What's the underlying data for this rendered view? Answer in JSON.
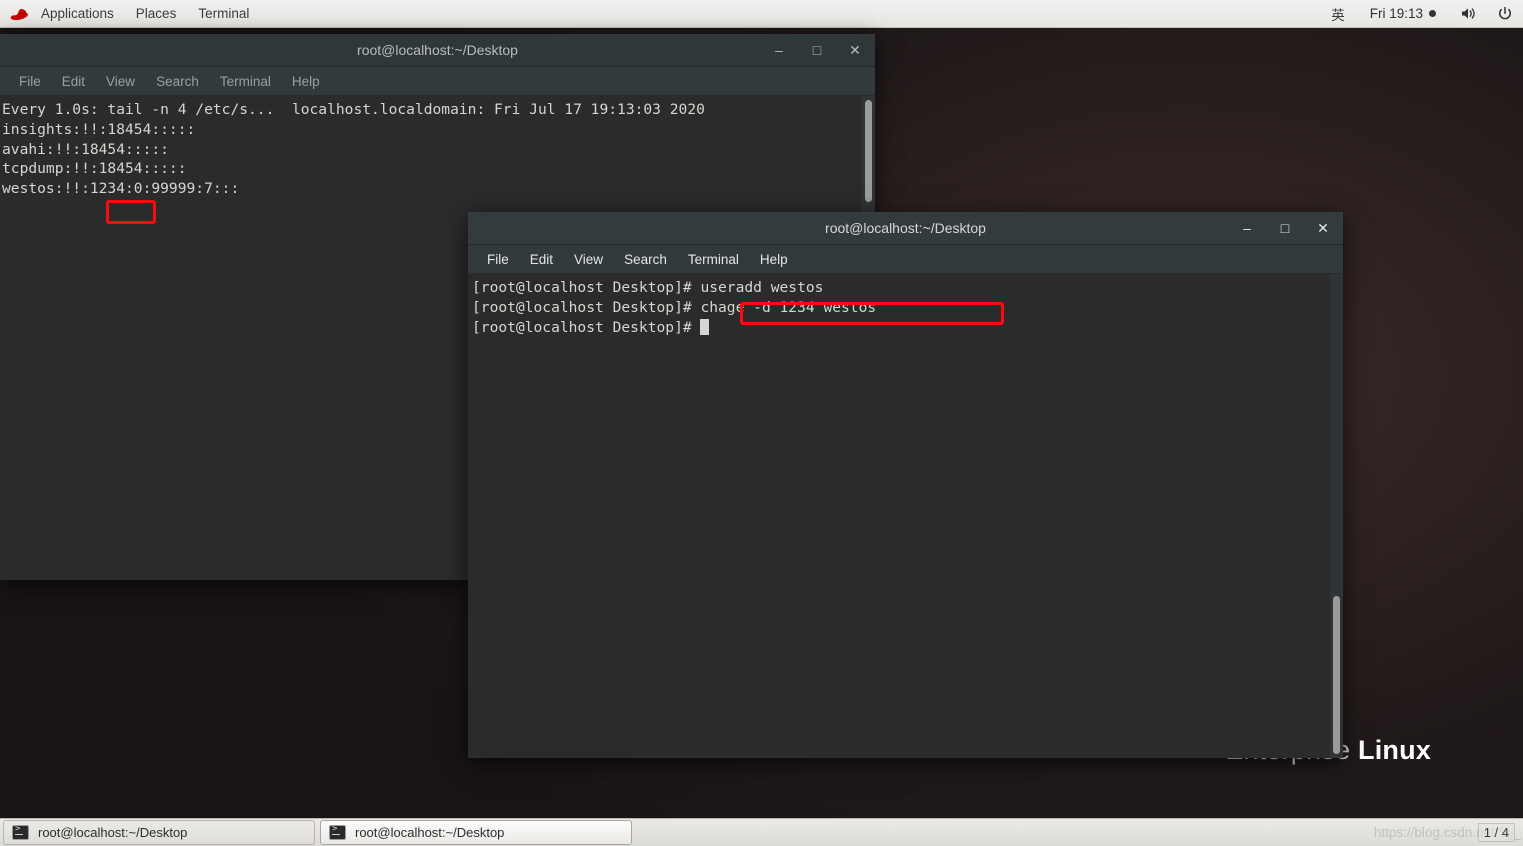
{
  "topbar": {
    "logo_icon": "redhat-logo-icon",
    "items": [
      "Applications",
      "Places",
      "Terminal"
    ],
    "input_method": "英",
    "clock": "Fri 19:13",
    "clock_indicator_icon": "notification-dot-icon",
    "volume_icon": "volume-icon",
    "power_icon": "power-icon"
  },
  "wallpaper": {
    "brand_thin": "Enterprise",
    "brand_bold": "Linux"
  },
  "windows": [
    {
      "title": "root@localhost:~/Desktop",
      "menu": [
        "File",
        "Edit",
        "View",
        "Search",
        "Terminal",
        "Help"
      ],
      "buttons": {
        "minimize": "–",
        "maximize": "□",
        "close": "✕"
      },
      "lines": [
        "Every 1.0s: tail -n 4 /etc/s...  localhost.localdomain: Fri Jul 17 19:13:03 2020",
        "",
        "insights:!!:18454:::::",
        "avahi:!!:18454:::::",
        "tcpdump:!!:18454:::::",
        "westos:!!:1234:0:99999:7:::"
      ]
    },
    {
      "title": "root@localhost:~/Desktop",
      "menu": [
        "File",
        "Edit",
        "View",
        "Search",
        "Terminal",
        "Help"
      ],
      "buttons": {
        "minimize": "–",
        "maximize": "□",
        "close": "✕"
      },
      "lines": [
        "[root@localhost Desktop]# useradd westos",
        "[root@localhost Desktop]# chage -d 1234 westos",
        "[root@localhost Desktop]# "
      ]
    }
  ],
  "annotations": {
    "color": "#fb0b0b",
    "highlight_shadow_value": "1234",
    "highlight_command": "chage -d 1234 westos"
  },
  "taskbar": {
    "buttons": [
      {
        "label": "root@localhost:~/Desktop",
        "icon": "terminal-icon"
      },
      {
        "label": "root@localhost:~/Desktop",
        "icon": "terminal-icon"
      }
    ],
    "watermark": "https://blog.csdn.net/Sjj_",
    "page_indicator": "1 / 4"
  }
}
